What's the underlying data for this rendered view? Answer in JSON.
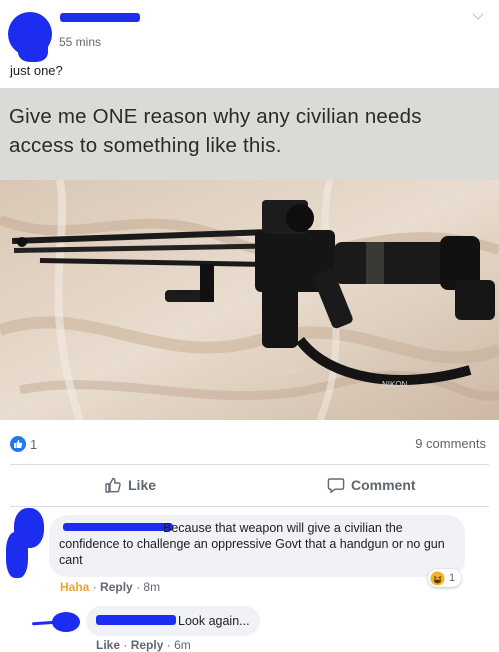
{
  "post": {
    "time": "55 mins",
    "text": "just one?",
    "meme_caption": "Give me ONE reason why any civilian needs access to something like this.",
    "strap_text_1": "Nikon",
    "strap_text_2": "NIKON"
  },
  "stats": {
    "like_count": "1",
    "comments": "9 comments"
  },
  "actions": {
    "like": "Like",
    "comment": "Comment"
  },
  "comments": [
    {
      "text": "Because that weapon will give a civilian the confidence to challenge an oppressive Govt that a handgun or no gun cant",
      "reaction_label": "Haha",
      "reply": "Reply",
      "time": "8m",
      "reaction_count": "1"
    },
    {
      "text": "Look again...",
      "like": "Like",
      "reply": "Reply",
      "time": "6m"
    }
  ],
  "colors": {
    "accent": "#2078f4",
    "redaction": "#1d2df0",
    "haha": "#f7b125"
  }
}
